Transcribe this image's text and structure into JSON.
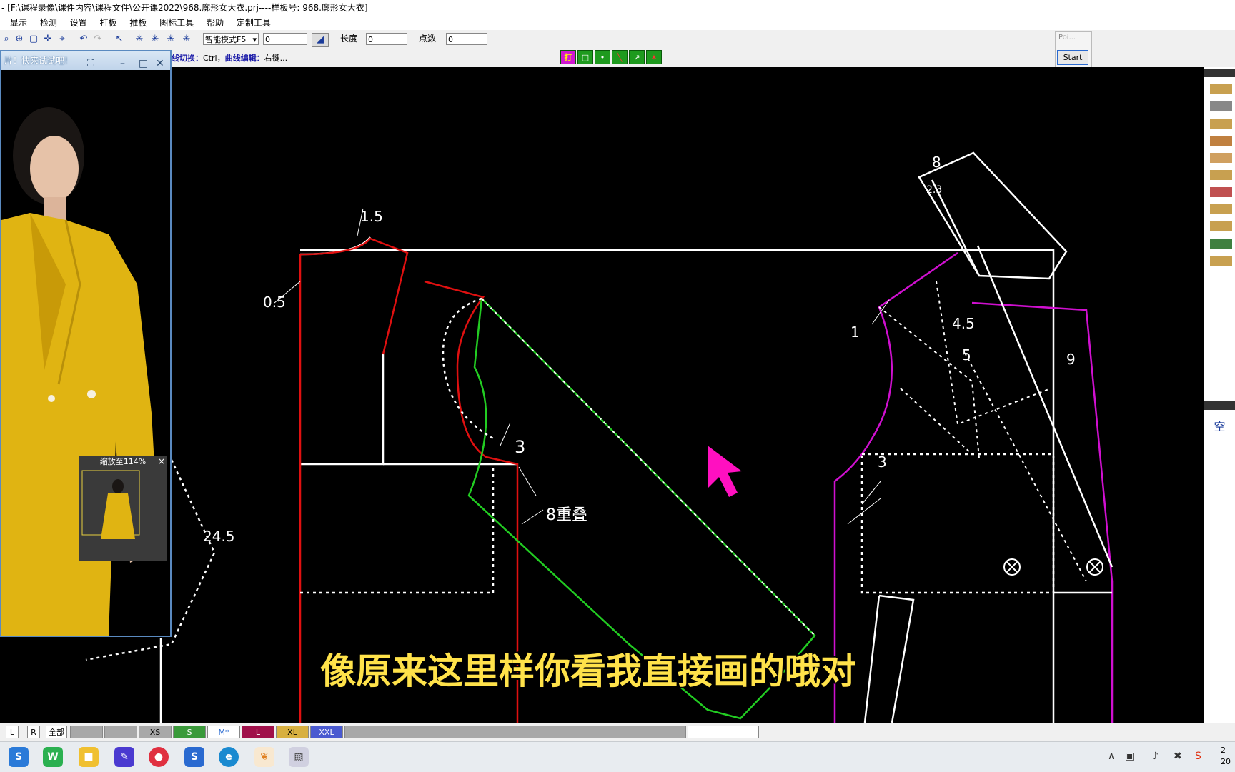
{
  "window": {
    "title": "- [F:\\课程录像\\课件内容\\课程文件\\公开课2022\\968.廓形女大衣.prj----样板号: 968.廓形女大衣]"
  },
  "menu": {
    "items": [
      "显示",
      "检测",
      "设置",
      "打板",
      "推板",
      "图标工具",
      "帮助",
      "定制工具"
    ]
  },
  "toolbar": {
    "mode_select": "智能模式F5",
    "input1_value": "0",
    "length_label": "长度",
    "length_value": "0",
    "points_label": "点数",
    "points_value": "0"
  },
  "hint": {
    "part1": "线切换：",
    "part2": "Ctrl，",
    "part3": "曲线编辑：",
    "part4": "右键..."
  },
  "green_tools": {
    "first": "打"
  },
  "poi_window": {
    "title": "Poi...",
    "start_label": "Start"
  },
  "preview_window": {
    "title": "片！快来试试吧!",
    "thumb_title": "缩放至114%",
    "thumb_close": "×"
  },
  "drawing": {
    "labels": {
      "l15": "1.5",
      "l05": "0.5",
      "l3a": "3",
      "l8": "8重叠",
      "l245": "24.5",
      "l8top": "8",
      "l23": "2.3",
      "l1": "1",
      "l45": "4.5",
      "l5": "5",
      "l9": "9",
      "l3b": "3"
    }
  },
  "right_panel": {
    "label": "空"
  },
  "subtitle": "像原来这里样你看我直接画的哦对",
  "sizebar": {
    "L": "L",
    "R": "R",
    "all": "全部",
    "sizes": [
      "XS",
      "S",
      "M*",
      "L",
      "XL",
      "XXL"
    ]
  },
  "taskbar": {
    "clock_line1": "2",
    "clock_line2": "20"
  },
  "colors": {
    "red_line": "#e01010",
    "green_line": "#22cc22",
    "magenta_line": "#d010d0",
    "subtitle": "#ffe24a",
    "cursor": "#ff10c0"
  }
}
